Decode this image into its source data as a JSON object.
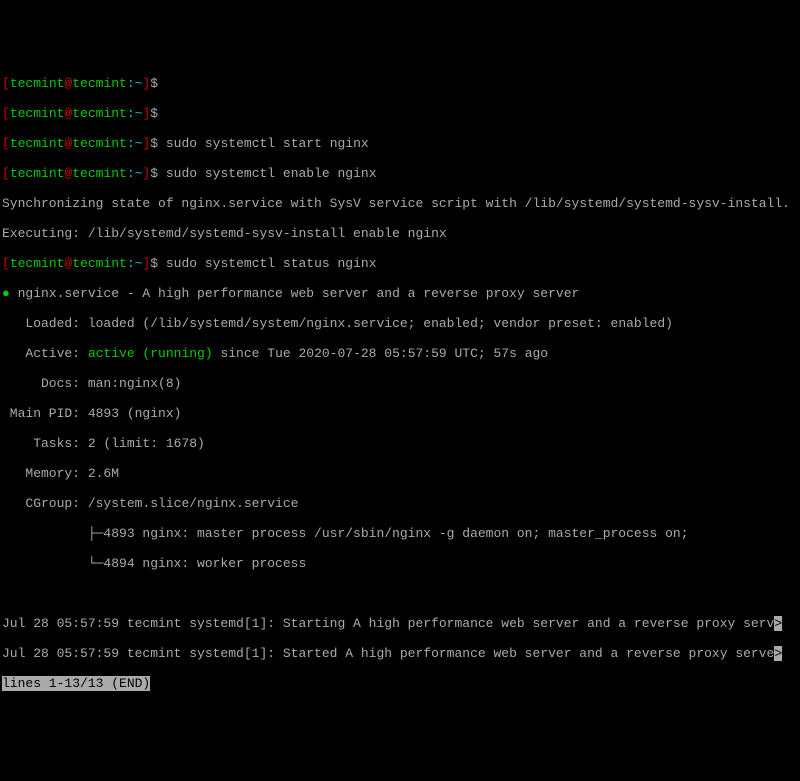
{
  "p": {
    "lb": "[",
    "user": "tecmint",
    "at": "@",
    "host": "tecmint",
    "path": ":~",
    "rb": "]",
    "sigil": "$ "
  },
  "cmd": {
    "empty": "",
    "start": "sudo systemctl start nginx",
    "enable": "sudo systemctl enable nginx",
    "status": "sudo systemctl status nginx"
  },
  "sync": "Synchronizing state of nginx.service with SysV service script with /lib/systemd/systemd-sysv-install.",
  "exec": "Executing: /lib/systemd/systemd-sysv-install enable nginx",
  "status": {
    "bullet": "●",
    "title": " nginx.service - A high performance web server and a reverse proxy server",
    "loaded_l": "   Loaded: ",
    "loaded_v": "loaded (/lib/systemd/system/nginx.service; enabled; vendor preset: enabled)",
    "active_l": "   Active: ",
    "active_v": "active (running)",
    "active_t": " since Tue 2020-07-28 05:57:59 UTC; 57s ago",
    "docs_l": "     Docs: ",
    "docs_v": "man:nginx(8)",
    "pid_l": " Main PID: ",
    "pid_v": "4893 (nginx)",
    "tasks_l": "    Tasks: ",
    "tasks_v": "2 (limit: 1678)",
    "mem_l": "   Memory: ",
    "mem_v": "2.6M",
    "cgrp_l": "   CGroup: ",
    "cgrp_v": "/system.slice/nginx.service",
    "tree1": "           ├─4893 nginx: master process /usr/sbin/nginx -g daemon on; master_process on;",
    "tree2": "           └─4894 nginx: worker process"
  },
  "log": {
    "l1": "Jul 28 05:57:59 tecmint systemd[1]: Starting A high performance web server and a reverse proxy serv",
    "e1": ">",
    "l2": "Jul 28 05:57:59 tecmint systemd[1]: Started A high performance web server and a reverse proxy serve",
    "e2": ">"
  },
  "pager": "lines 1-13/13 (END)"
}
